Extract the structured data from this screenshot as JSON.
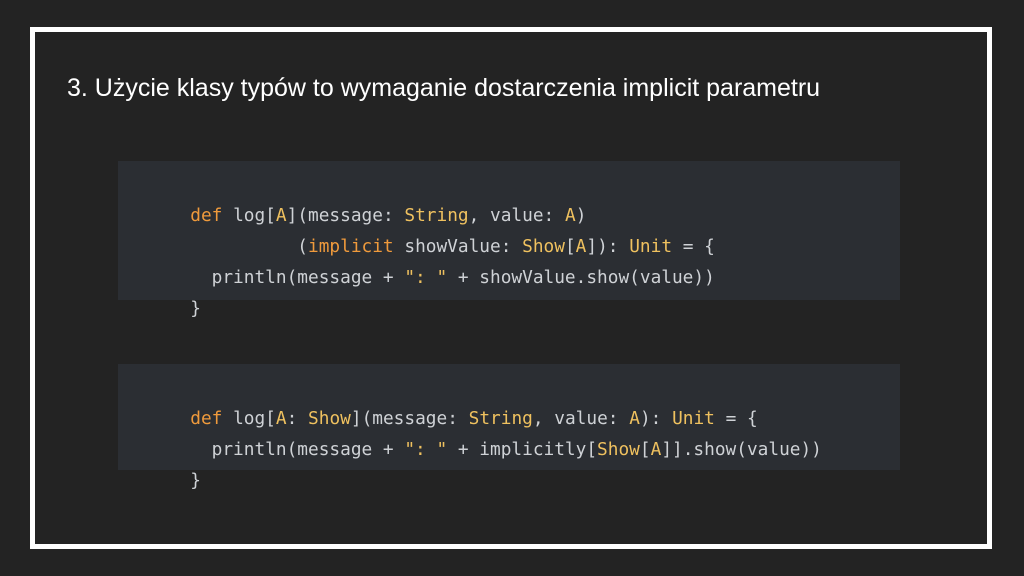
{
  "slide": {
    "title": "3. Użycie klasy typów to wymaganie dostarczenia implicit parametru"
  },
  "code_block_1": {
    "lines": [
      [
        {
          "t": "def",
          "k": "kw"
        },
        {
          "t": " log[",
          "k": "pl"
        },
        {
          "t": "A",
          "k": "ty"
        },
        {
          "t": "](message: ",
          "k": "pl"
        },
        {
          "t": "String",
          "k": "ty"
        },
        {
          "t": ", value: ",
          "k": "pl"
        },
        {
          "t": "A",
          "k": "ty"
        },
        {
          "t": ")",
          "k": "pl"
        }
      ],
      [
        {
          "t": "          (",
          "k": "pl"
        },
        {
          "t": "implicit",
          "k": "kw"
        },
        {
          "t": " showValue: ",
          "k": "pl"
        },
        {
          "t": "Show",
          "k": "ty"
        },
        {
          "t": "[",
          "k": "pl"
        },
        {
          "t": "A",
          "k": "ty"
        },
        {
          "t": "]): ",
          "k": "pl"
        },
        {
          "t": "Unit",
          "k": "ty"
        },
        {
          "t": " = {",
          "k": "pl"
        }
      ],
      [
        {
          "t": "  println(message + ",
          "k": "pl"
        },
        {
          "t": "\": \"",
          "k": "st"
        },
        {
          "t": " + showValue.show(value))",
          "k": "pl"
        }
      ],
      [
        {
          "t": "}",
          "k": "pl"
        }
      ]
    ]
  },
  "code_block_2": {
    "lines": [
      [
        {
          "t": "def",
          "k": "kw"
        },
        {
          "t": " log[",
          "k": "pl"
        },
        {
          "t": "A",
          "k": "ty"
        },
        {
          "t": ": ",
          "k": "pl"
        },
        {
          "t": "Show",
          "k": "ty"
        },
        {
          "t": "](message: ",
          "k": "pl"
        },
        {
          "t": "String",
          "k": "ty"
        },
        {
          "t": ", value: ",
          "k": "pl"
        },
        {
          "t": "A",
          "k": "ty"
        },
        {
          "t": "): ",
          "k": "pl"
        },
        {
          "t": "Unit",
          "k": "ty"
        },
        {
          "t": " = {",
          "k": "pl"
        }
      ],
      [
        {
          "t": "  println(message + ",
          "k": "pl"
        },
        {
          "t": "\": \"",
          "k": "st"
        },
        {
          "t": " + implicitly[",
          "k": "pl"
        },
        {
          "t": "Show",
          "k": "ty"
        },
        {
          "t": "[",
          "k": "pl"
        },
        {
          "t": "A",
          "k": "ty"
        },
        {
          "t": "]].show(value))",
          "k": "pl"
        }
      ],
      [
        {
          "t": "}",
          "k": "pl"
        }
      ]
    ]
  },
  "colors": {
    "background": "#232323",
    "frame": "#ffffff",
    "code_background": "#2b2e33",
    "code_text": "#cfd2d6",
    "keyword": "#ef9a3c",
    "type": "#efc15f"
  }
}
